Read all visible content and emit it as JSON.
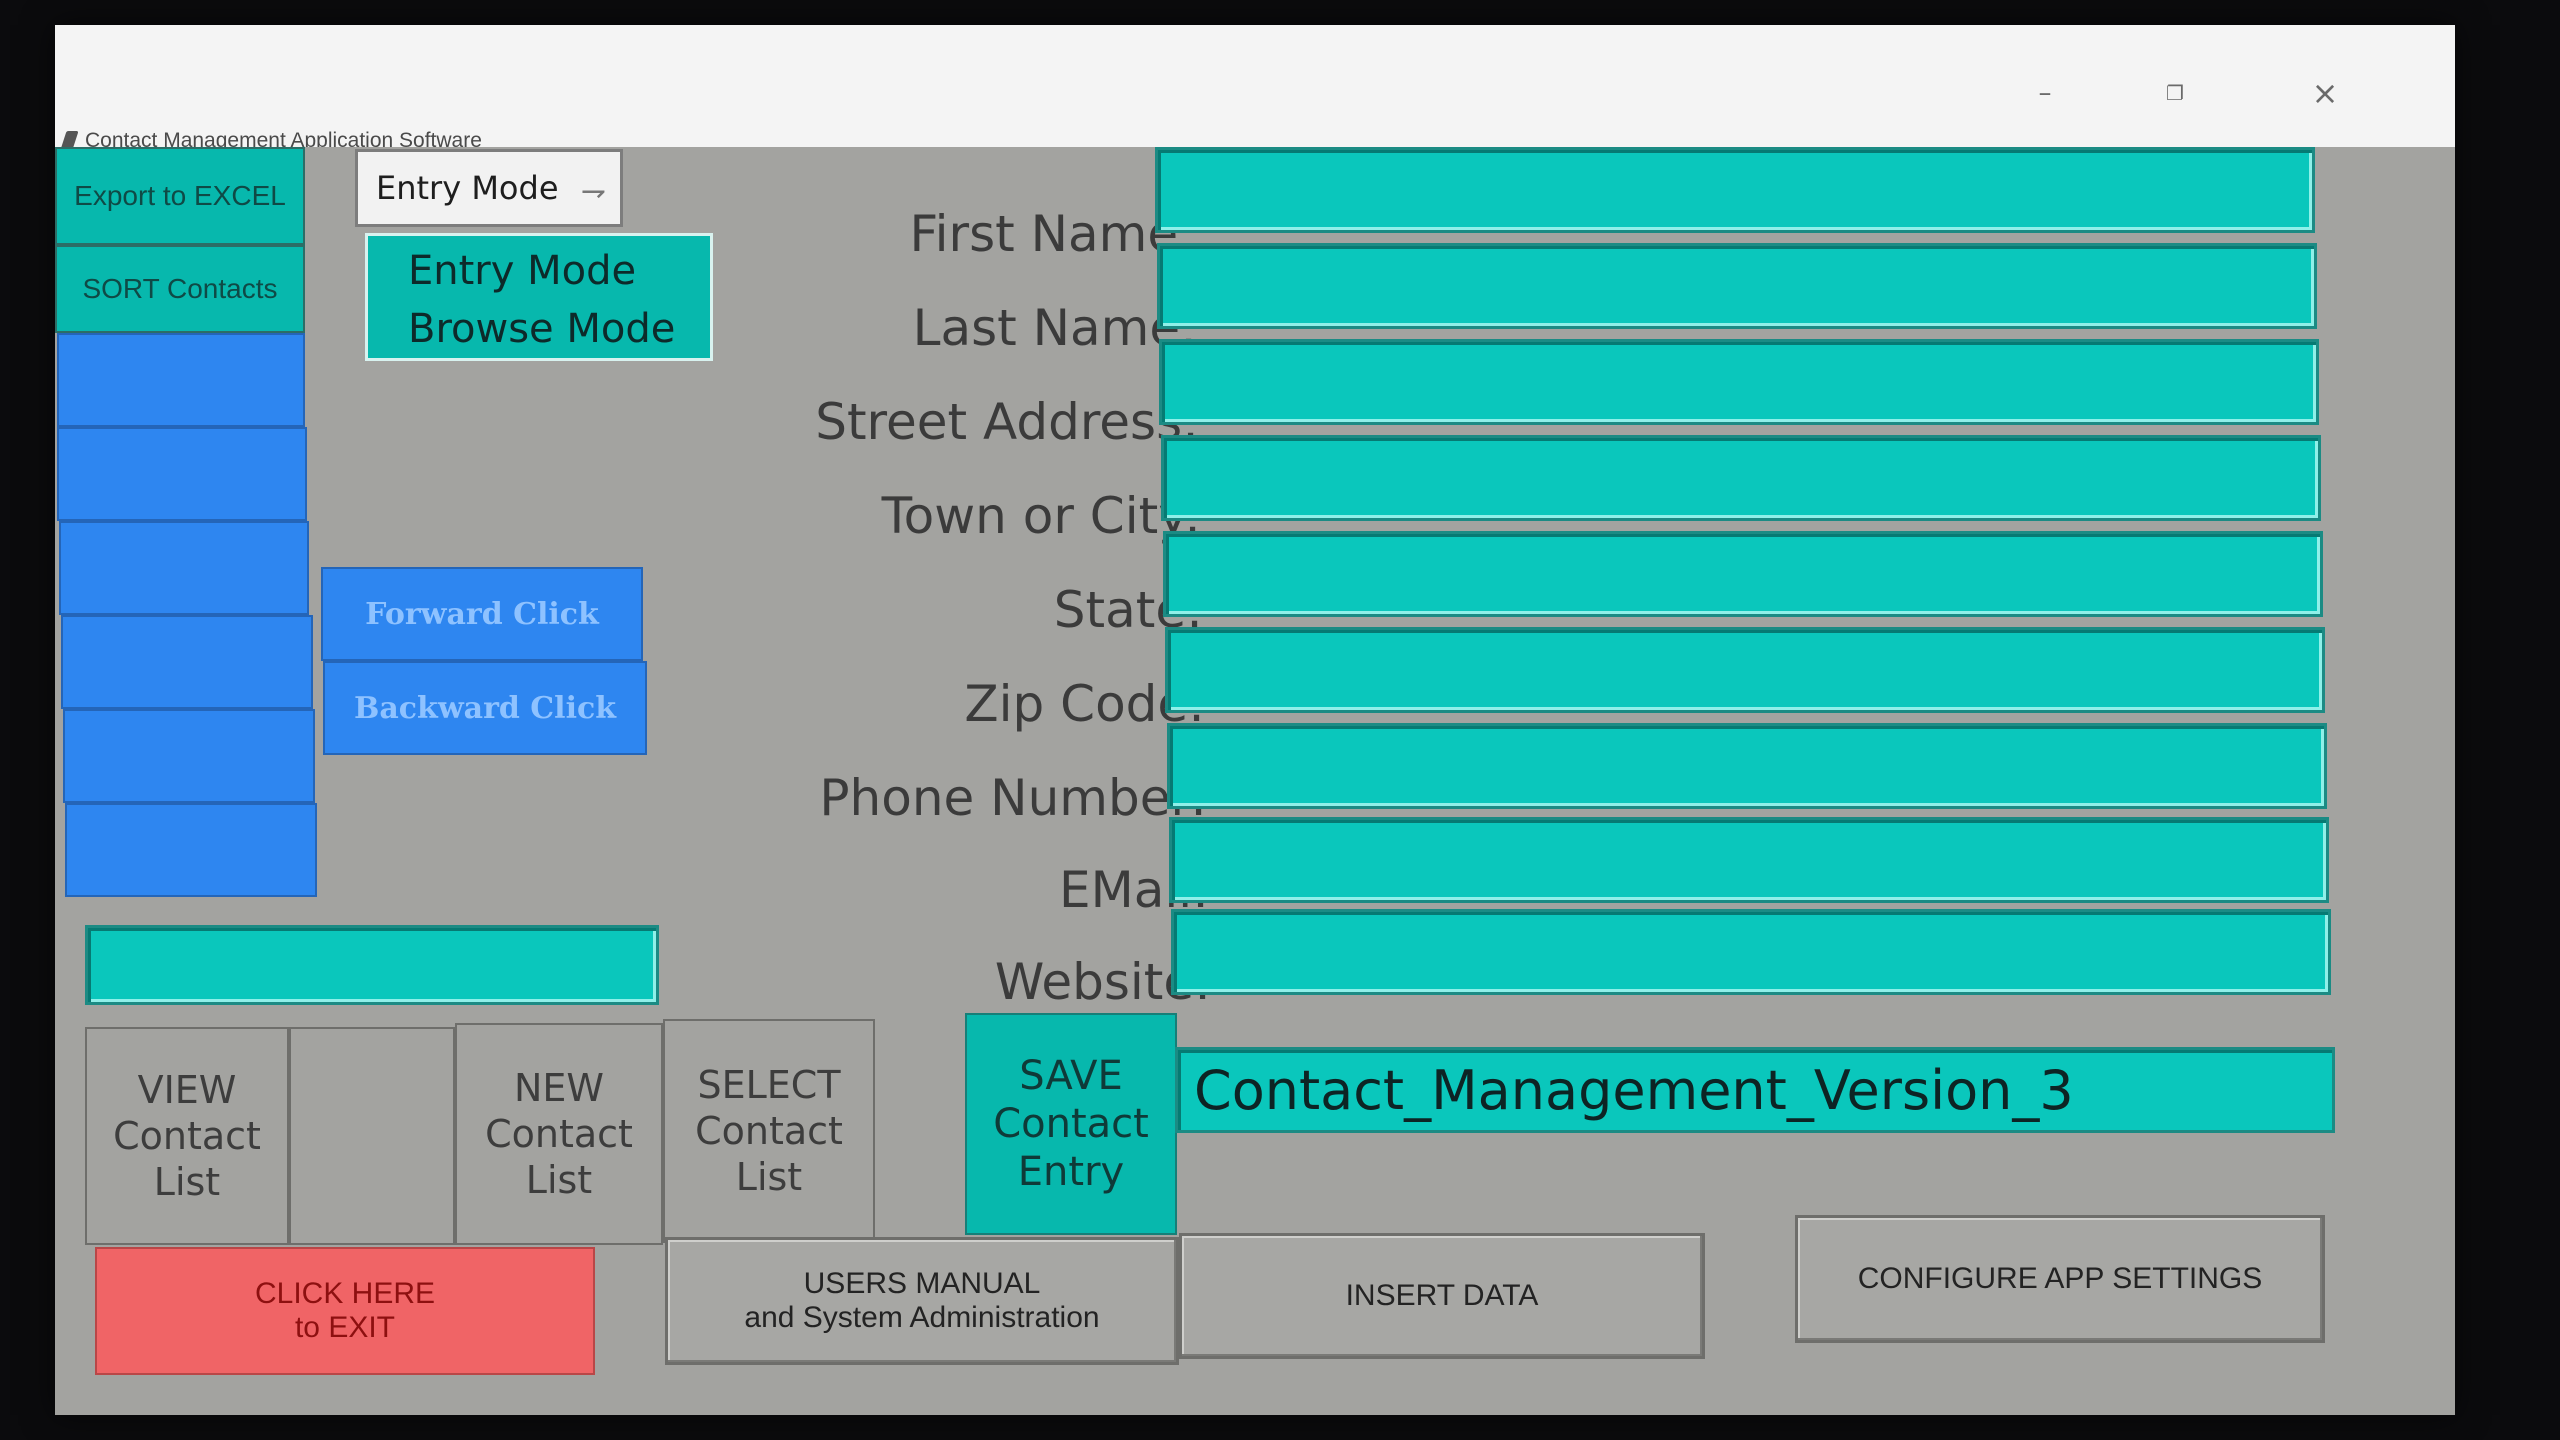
{
  "window": {
    "title": "Contact Management Application Software",
    "controls": {
      "minimize": "–",
      "restore": "❐",
      "close": "×"
    }
  },
  "sidebar": {
    "export_label": "Export to EXCEL",
    "sort_label": "SORT Contacts"
  },
  "mode_selector": {
    "selected": "Entry Mode",
    "options": [
      "Entry Mode",
      "Browse Mode"
    ]
  },
  "navigation": {
    "forward_label": "Forward Click",
    "backward_label": "Backward Click"
  },
  "form": {
    "fields": [
      {
        "label": "First Name:",
        "value": ""
      },
      {
        "label": "Last Name:",
        "value": ""
      },
      {
        "label": "Street Address:",
        "value": ""
      },
      {
        "label": "Town or City:",
        "value": ""
      },
      {
        "label": "State:",
        "value": ""
      },
      {
        "label": "Zip Code:",
        "value": ""
      },
      {
        "label": "Phone Number:",
        "value": ""
      },
      {
        "label": "EMail:",
        "value": ""
      },
      {
        "label": "Website:",
        "value": ""
      }
    ],
    "database_name": "Contact_Management_Version_3"
  },
  "actions": {
    "view": [
      "VIEW",
      "Contact",
      "List"
    ],
    "new": [
      "NEW",
      "Contact",
      "List"
    ],
    "select": [
      "SELECT",
      "Contact",
      "List"
    ],
    "save": [
      "SAVE",
      "Contact",
      "Entry"
    ],
    "exit": [
      "CLICK HERE",
      "to EXIT"
    ],
    "manual": [
      "USERS MANUAL",
      "and System Administration"
    ],
    "insert": "INSERT DATA",
    "configure": "CONFIGURE APP SETTINGS"
  },
  "colors": {
    "teal": "#07b8ad",
    "blue": "#2e86f0",
    "exit_red": "#f06466",
    "window_gray": "#a3a3a0"
  }
}
